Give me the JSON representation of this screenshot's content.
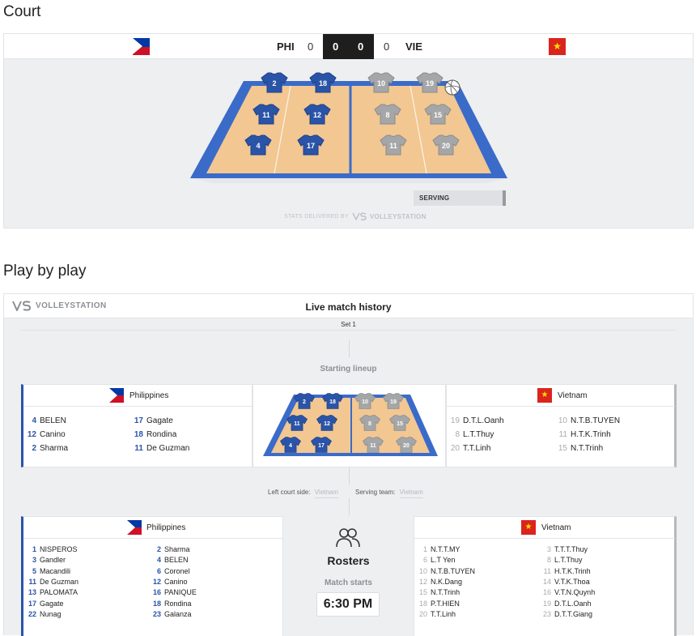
{
  "court": {
    "title": "Court",
    "home": {
      "code": "PHI",
      "set_score": "0",
      "current_points": "0"
    },
    "away": {
      "code": "VIE",
      "set_score": "0",
      "current_points": "0"
    },
    "serving_label": "SERVING",
    "credit": {
      "prefix": "STATS DELIVERED BY",
      "brand": "VOLLEYSTATION"
    },
    "home_positions": [
      "2",
      "18",
      "11",
      "12",
      "4",
      "17"
    ],
    "away_positions": [
      "10",
      "19",
      "8",
      "15",
      "11",
      "20"
    ],
    "colors": {
      "home_jersey": "#2a54a8",
      "away_jersey": "#a5a6a8",
      "court_blue": "#3a6bc9",
      "court_floor": "#f2c792"
    }
  },
  "pbp": {
    "title": "Play by play",
    "brand": "VOLLEYSTATION",
    "header_title": "Live match history",
    "set_label": "Set 1",
    "starting_lineup_label": "Starting lineup",
    "left_court_label": "Left court side:",
    "left_court_value": "Vietnam",
    "serving_team_label": "Serving team:",
    "serving_team_value": "Vietnam",
    "home_name": "Philippines",
    "away_name": "Vietnam",
    "home_lineup": [
      {
        "num": "4",
        "name": "BELEN"
      },
      {
        "num": "17",
        "name": "Gagate"
      },
      {
        "num": "12",
        "name": "Canino"
      },
      {
        "num": "18",
        "name": "Rondina"
      },
      {
        "num": "2",
        "name": "Sharma"
      },
      {
        "num": "11",
        "name": "De Guzman"
      }
    ],
    "away_lineup": [
      {
        "num": "19",
        "name": "D.T.L.Oanh"
      },
      {
        "num": "10",
        "name": "N.T.B.TUYEN"
      },
      {
        "num": "8",
        "name": "L.T.Thuy"
      },
      {
        "num": "11",
        "name": "H.T.K.Trinh"
      },
      {
        "num": "20",
        "name": "T.T.Linh"
      },
      {
        "num": "15",
        "name": "N.T.Trinh"
      }
    ],
    "rosters_label": "Rosters",
    "match_starts_label": "Match starts",
    "match_time": "6:30 PM",
    "home_roster": [
      {
        "num": "1",
        "name": "NISPEROS"
      },
      {
        "num": "2",
        "name": "Sharma"
      },
      {
        "num": "3",
        "name": "Gandler"
      },
      {
        "num": "4",
        "name": "BELEN"
      },
      {
        "num": "5",
        "name": "Macandili"
      },
      {
        "num": "6",
        "name": "Coronel"
      },
      {
        "num": "11",
        "name": "De Guzman"
      },
      {
        "num": "12",
        "name": "Canino"
      },
      {
        "num": "13",
        "name": "PALOMATA"
      },
      {
        "num": "16",
        "name": "PANIQUE"
      },
      {
        "num": "17",
        "name": "Gagate"
      },
      {
        "num": "18",
        "name": "Rondina"
      },
      {
        "num": "22",
        "name": "Nunag"
      },
      {
        "num": "23",
        "name": "Galanza"
      }
    ],
    "away_roster": [
      {
        "num": "1",
        "name": "N.T.T.MY"
      },
      {
        "num": "3",
        "name": "T.T.T.Thuy"
      },
      {
        "num": "6",
        "name": "L.T Yen"
      },
      {
        "num": "8",
        "name": "L.T.Thuy"
      },
      {
        "num": "10",
        "name": "N.T.B.TUYEN"
      },
      {
        "num": "11",
        "name": "H.T.K.Trinh"
      },
      {
        "num": "12",
        "name": "N.K.Dang"
      },
      {
        "num": "14",
        "name": "V.T.K.Thoa"
      },
      {
        "num": "15",
        "name": "N.T.Trinh"
      },
      {
        "num": "16",
        "name": "V.T.N.Quynh"
      },
      {
        "num": "18",
        "name": "P.T.HIEN"
      },
      {
        "num": "19",
        "name": "D.T.L.Oanh"
      },
      {
        "num": "20",
        "name": "T.T.Linh"
      },
      {
        "num": "23",
        "name": "D.T.T.Giang"
      }
    ]
  }
}
